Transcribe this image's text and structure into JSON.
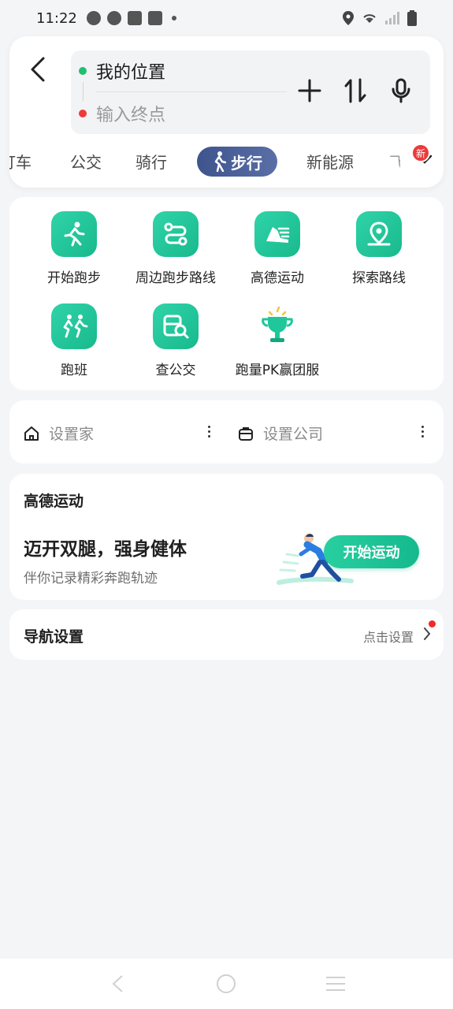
{
  "status_bar": {
    "time": "11:22",
    "icons": [
      "speedometer-icon",
      "info-icon",
      "mail-icon",
      "bag-icon",
      "dot-icon",
      "location-icon",
      "wifi-icon",
      "signal-icon",
      "battery-icon"
    ]
  },
  "route": {
    "start_label": "我的位置",
    "end_placeholder": "输入终点",
    "start_color": "#1fbf6f",
    "end_color": "#ee3a3a",
    "actions": [
      "add-icon",
      "swap-icon",
      "mic-icon"
    ]
  },
  "modes": {
    "items": [
      "打车",
      "公交",
      "骑行",
      "步行",
      "新能源",
      "飞"
    ],
    "active": "步行",
    "badge": "新"
  },
  "shortcuts": [
    {
      "label": "开始跑步",
      "icon": "running-icon"
    },
    {
      "label": "周边跑步路线",
      "icon": "route-icon"
    },
    {
      "label": "高德运动",
      "icon": "sport-shoe-icon"
    },
    {
      "label": "探索路线",
      "icon": "map-pin-icon"
    },
    {
      "label": "跑班",
      "icon": "group-run-icon"
    },
    {
      "label": "查公交",
      "icon": "bus-search-icon"
    },
    {
      "label": "跑量PK赢团服",
      "icon": "trophy-icon"
    }
  ],
  "places": {
    "home": "设置家",
    "company": "设置公司"
  },
  "sport": {
    "title": "高德运动",
    "headline": "迈开双腿，强身健体",
    "subtitle": "伴你记录精彩奔跑轨迹",
    "button": "开始运动"
  },
  "nav_settings": {
    "title": "导航设置",
    "hint": "点击设置"
  },
  "colors": {
    "accent_green": "#1fc79a",
    "tab_active": "#3e548d",
    "badge_red": "#ee3a3a"
  }
}
